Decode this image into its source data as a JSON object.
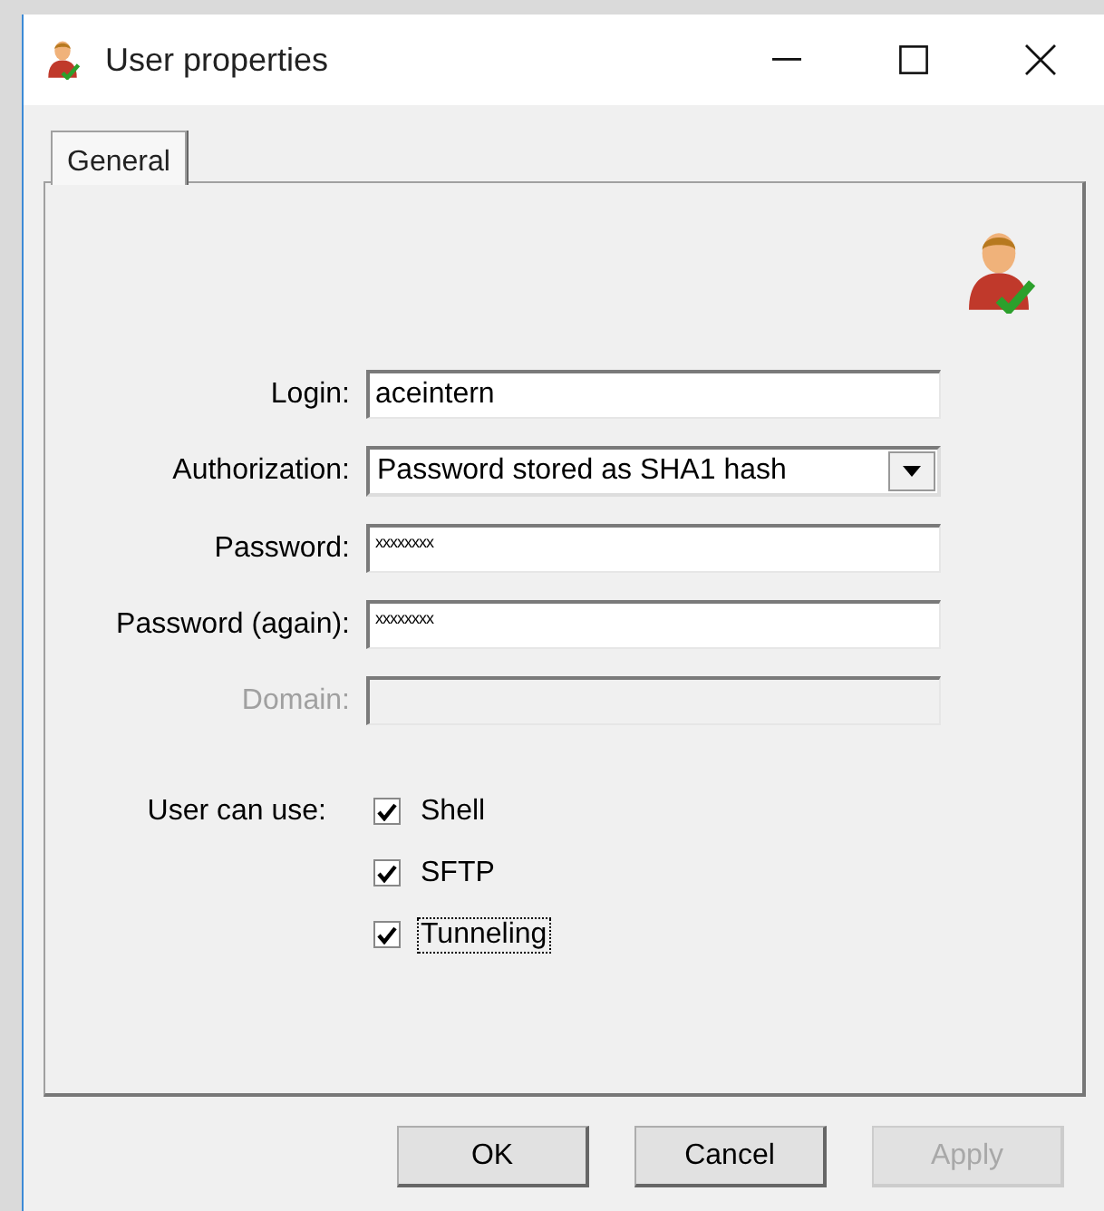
{
  "window": {
    "title": "User properties"
  },
  "tabs": [
    {
      "label": "General",
      "selected": true
    }
  ],
  "fields": [
    {
      "kind": "text",
      "label": "Login:",
      "value": "aceintern",
      "disabled": false
    },
    {
      "kind": "select",
      "label": "Authorization:",
      "value": "Password stored as SHA1 hash",
      "disabled": false
    },
    {
      "kind": "password",
      "label": "Password:",
      "value": "xxxxxxxx",
      "disabled": false
    },
    {
      "kind": "password",
      "label": "Password (again):",
      "value": "xxxxxxxx",
      "disabled": false
    },
    {
      "kind": "text",
      "label": "Domain:",
      "disabled": true
    }
  ],
  "permissions": {
    "label": "User can use:",
    "options": [
      {
        "label": "Shell",
        "checked": true,
        "focused": false
      },
      {
        "label": "SFTP",
        "checked": true,
        "focused": false
      },
      {
        "label": "Tunneling",
        "checked": true,
        "focused": true
      }
    ]
  },
  "buttons": [
    {
      "label": "OK",
      "disabled": false
    },
    {
      "label": "Cancel",
      "disabled": false
    },
    {
      "label": "Apply",
      "disabled": true
    }
  ]
}
